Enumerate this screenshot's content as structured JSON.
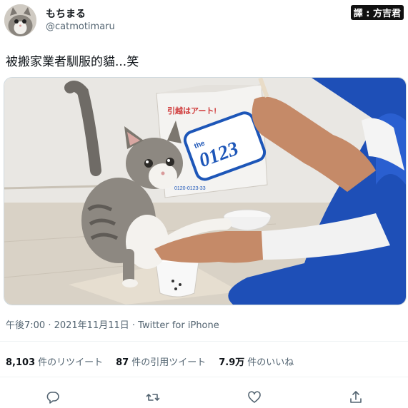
{
  "author": {
    "display_name": "もちまる",
    "handle": "@catmotimaru"
  },
  "watermark": "譯 : 方吉君",
  "tweet": {
    "text": "被搬家業者馴服的貓...笑",
    "timestamp": "午後7:00 · 2021年11月11日 · Twitter for iPhone"
  },
  "photo": {
    "box_brand": "引越はアート!",
    "box_logo_small": "the",
    "box_logo_number": "0123",
    "box_phone": "0120-0123-33"
  },
  "stats": {
    "retweets": {
      "value": "8,103",
      "label": "件のリツイート"
    },
    "quotes": {
      "value": "87",
      "label": "件の引用ツイート"
    },
    "likes": {
      "value": "7.9万",
      "label": "件のいいね"
    }
  },
  "actions": [
    "reply-icon",
    "retweet-icon",
    "like-icon",
    "share-icon"
  ]
}
